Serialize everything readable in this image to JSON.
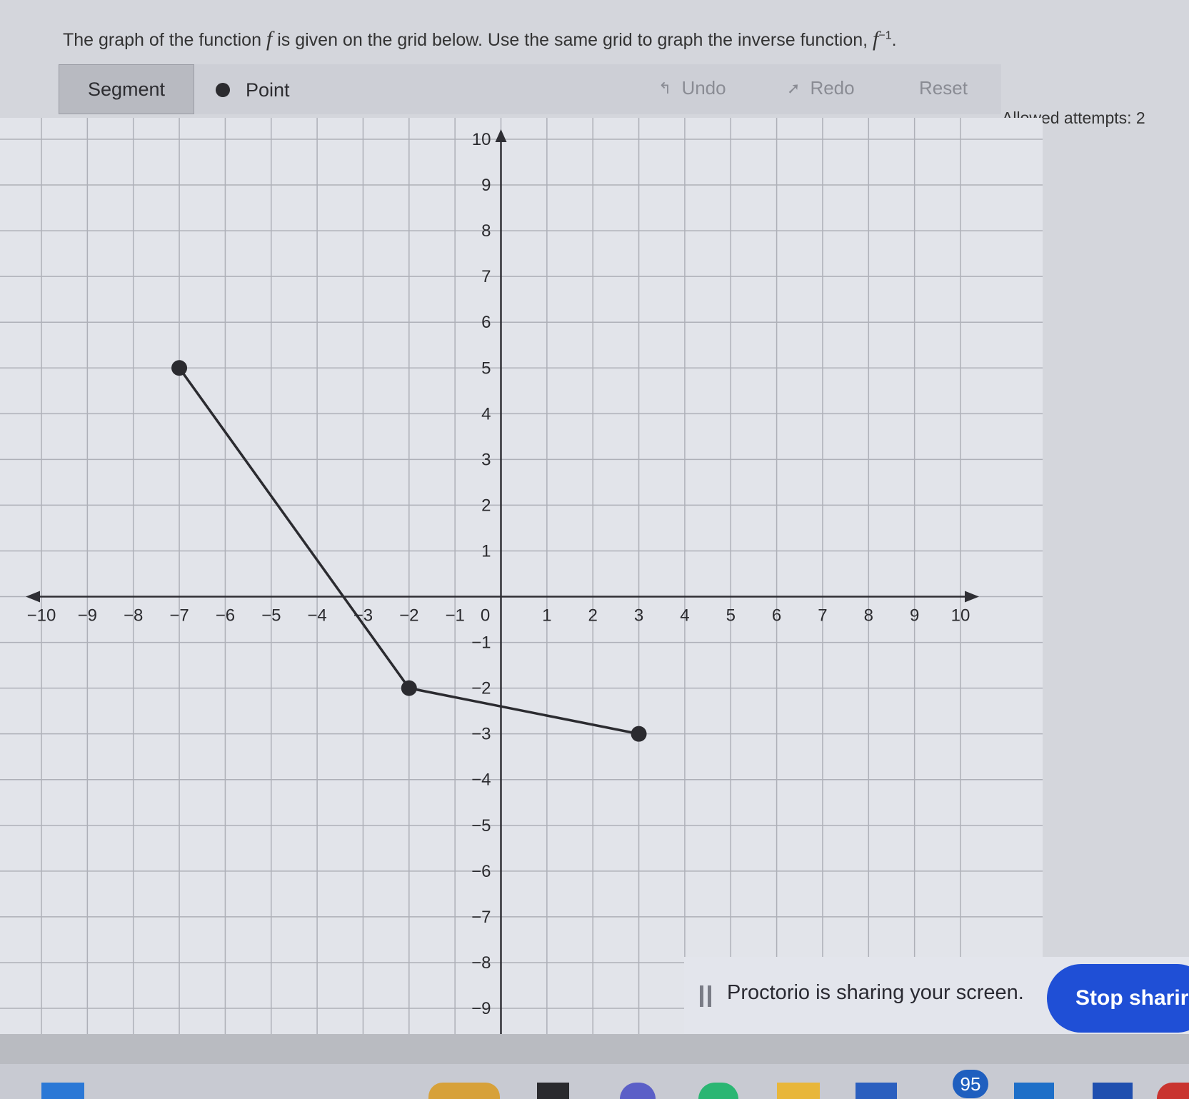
{
  "question": {
    "part1": "The graph of the function ",
    "fn": "f",
    "part2": " is given on the grid below. Use the same grid to graph the inverse function, ",
    "sup": "−1",
    "end": "."
  },
  "toolbar": {
    "segment_label": "Segment",
    "point_label": "Point",
    "undo_label": "Undo",
    "redo_label": "Redo",
    "reset_label": "Reset"
  },
  "attempts_label": "Allowed attempts: 2",
  "chart_data": {
    "type": "line",
    "xlim": [
      -10,
      10
    ],
    "ylim": [
      -9,
      10
    ],
    "x_ticks": [
      "−10",
      "−9",
      "−8",
      "−7",
      "−6",
      "−5",
      "−4",
      "−3",
      "−2",
      "−1",
      "1",
      "2",
      "3",
      "4",
      "5",
      "6",
      "7",
      "8",
      "9",
      "10"
    ],
    "y_ticks": [
      "10",
      "9",
      "8",
      "7",
      "6",
      "5",
      "4",
      "3",
      "2",
      "1",
      "−1",
      "−2",
      "−3",
      "−4",
      "−5",
      "−6",
      "−7",
      "−8",
      "−9"
    ],
    "origin_label": "0",
    "grid": true,
    "series": [
      {
        "points": [
          [
            -7,
            5
          ],
          [
            -2,
            -2
          ],
          [
            3,
            -3
          ]
        ]
      }
    ],
    "colors": {
      "line": "#2b2b30",
      "grid": "#aeb0b8",
      "axis": "#2f2f35"
    }
  },
  "proctor": {
    "message": "Proctorio is sharing your screen.",
    "stop_label": "Stop sharir"
  },
  "taskbar": {
    "badge": "95"
  }
}
